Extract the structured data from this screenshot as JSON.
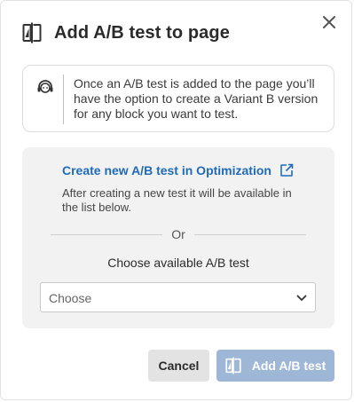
{
  "dialog": {
    "title": "Add A/B test to page",
    "close_icon": "close-icon",
    "title_icon": "ab-split-icon"
  },
  "info": {
    "icon": "support-agent-icon",
    "text": "Once an A/B test is added to the page you’ll have the option to create a Variant B version for any block you want to test."
  },
  "panel": {
    "create_link": "Create new A/B test in Optimization",
    "external_icon": "external-link-icon",
    "help_text": "After creating a new test it will be available in the list below.",
    "or_text": "Or",
    "choose_label": "Choose available A/B test",
    "select": {
      "value": "Choose",
      "icon": "chevron-down-icon"
    }
  },
  "footer": {
    "cancel_label": "Cancel",
    "add_label": "Add A/B test",
    "add_icon": "ab-split-icon"
  },
  "colors": {
    "link": "#1f6bb8",
    "panel_bg": "#f2f2f2",
    "primary_disabled": "#9fb7d6",
    "secondary": "#e3e3e3"
  }
}
